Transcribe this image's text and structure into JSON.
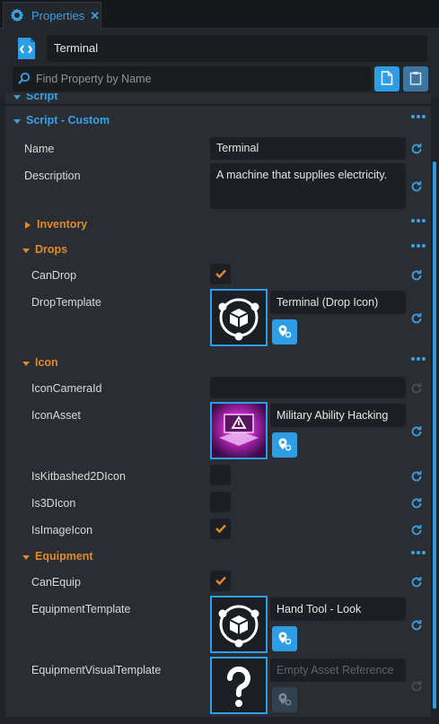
{
  "tab": {
    "title": "Properties",
    "icon": "gear-icon",
    "close_icon": "close-icon"
  },
  "header": {
    "object_name": "Terminal",
    "object_icon": "script-file-icon",
    "search_placeholder": "Find Property by Name",
    "search_icon": "search-icon",
    "copy_icon": "document-icon",
    "paste_icon": "clipboard-icon"
  },
  "sections": {
    "script": {
      "title": "Script"
    },
    "script_custom": {
      "title": "Script - Custom"
    },
    "inventory": {
      "title": "Inventory"
    },
    "drops": {
      "title": "Drops"
    },
    "icon": {
      "title": "Icon"
    },
    "equipment": {
      "title": "Equipment"
    }
  },
  "props": {
    "name": {
      "label": "Name",
      "value": "Terminal"
    },
    "description": {
      "label": "Description",
      "value": "A machine that supplies electricity."
    },
    "candrop": {
      "label": "CanDrop",
      "checked": true
    },
    "droptemplate": {
      "label": "DropTemplate",
      "asset": "Terminal (Drop Icon)"
    },
    "iconcameraid": {
      "label": "IconCameraId",
      "value": ""
    },
    "iconasset": {
      "label": "IconAsset",
      "asset": "Military Ability Hacking"
    },
    "iskitbashed": {
      "label": "IsKitbashed2DIcon",
      "checked": false
    },
    "is3dicon": {
      "label": "Is3DIcon",
      "checked": false
    },
    "isimageicon": {
      "label": "IsImageIcon",
      "checked": true
    },
    "canequip": {
      "label": "CanEquip",
      "checked": true
    },
    "equipmenttemplate": {
      "label": "EquipmentTemplate",
      "asset": "Hand Tool - Look"
    },
    "equipmentvisual": {
      "label": "EquipmentVisualTemplate",
      "placeholder": "Empty Asset Reference"
    }
  },
  "colors": {
    "accent": "#2d9ee5",
    "section_blue": "#3aa0e6",
    "section_orange": "#e08a2e",
    "check_orange": "#e08a2e"
  }
}
